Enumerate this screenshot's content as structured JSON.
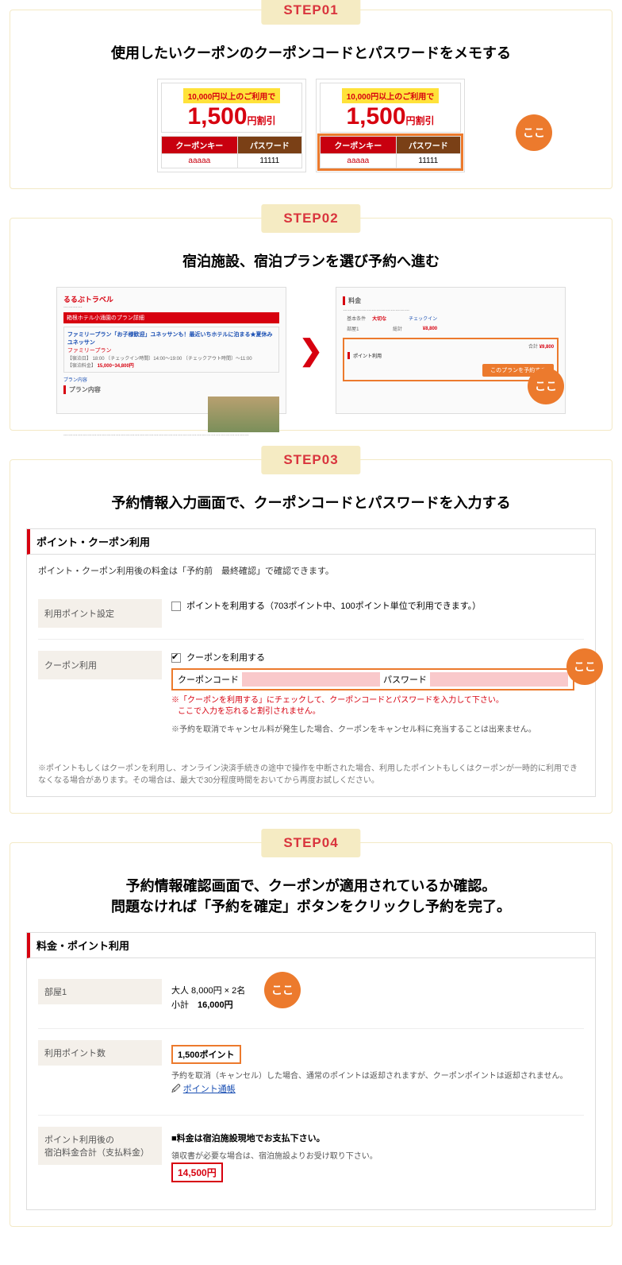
{
  "common": {
    "koko": "ここ",
    "arrow": "❯"
  },
  "step1": {
    "tab": "STEP01",
    "title": "使用したいクーポンのクーポンコードとパスワードをメモする",
    "coupon": {
      "condition": "10,000円以上のご利用で",
      "amount": "1,500",
      "unit": "円割引",
      "key_header": "クーポンキー",
      "pw_header": "パスワード",
      "key_value": "aaaaa",
      "pw_value": "11111"
    }
  },
  "step2": {
    "tab": "STEP02",
    "title": "宿泊施設、宿泊プランを選び予約へ進む",
    "left": {
      "logo": "るるぶトラベル",
      "bar": "箱根ホテル小涌園のプラン詳細",
      "plan_title": "ファミリープラン「お子様歓迎」ユネッサンも！最近いちホテルに泊まる★夏休みユネッサン",
      "plan_sub": "ファミリープラン",
      "plan_link": "プラン内容",
      "date_label": "【宿泊日】",
      "checkin": "18:00 〔チェックイン時間〕14:00～19:00",
      "checkout": "〔チェックアウト時間〕～11:00",
      "price_label": "【宿泊料金】",
      "price": "15,000~34,800円"
    },
    "right": {
      "header": "料金",
      "client_lbl": "基本条件",
      "required": "大切な",
      "room_lbl": "部屋1",
      "total_lbl": "総計",
      "total_val": "¥8,800",
      "sum_lbl": "合計",
      "sum_val": "¥9,800",
      "points": "ポイント利用",
      "button": "このプランを予約する"
    }
  },
  "step3": {
    "tab": "STEP03",
    "title": "予約情報入力画面で、クーポンコードとパスワードを入力する",
    "panel_header": "ポイント・クーポン利用",
    "note": "ポイント・クーポン利用後の料金は「予約前　最終確認」で確認できます。",
    "point_label": "利用ポイント設定",
    "point_text": "ポイントを利用する（703ポイント中、100ポイント単位で利用できます。）",
    "coupon_label": "クーポン利用",
    "coupon_use": "クーポンを利用する",
    "code_label": "クーポンコード",
    "pw_label": "パスワード",
    "warn1": "※「クーポンを利用する」にチェックして、クーポンコードとパスワードを入力して下さい。",
    "warn2": "ここで入力を忘れると割引されません。",
    "cancel_note": "※予約を取消でキャンセル料が発生した場合、クーポンをキャンセル料に充当することは出来ません。",
    "foot": "※ポイントもしくはクーポンを利用し、オンライン決済手続きの途中で操作を中断された場合、利用したポイントもしくはクーポンが一時的に利用できなくなる場合があります。その場合は、最大で30分程度時間をおいてから再度お試しください。"
  },
  "step4": {
    "tab": "STEP04",
    "title1": "予約情報確認画面で、クーポンが適用されているか確認。",
    "title2": "問題なければ「予約を確定」ボタンをクリックし予約を完了。",
    "panel_header": "料金・ポイント利用",
    "room_label": "部屋1",
    "room_line1": "大人 8,000円 × 2名",
    "room_line2_lbl": "小計",
    "room_line2_val": "16,000円",
    "points_label": "利用ポイント数",
    "points_value": "1,500ポイント",
    "points_note": "予約を取消（キャンセル）した場合、通常のポイントは返却されますが、クーポンポイントは返却されません。",
    "points_link": "ポイント通帳",
    "points_link_icon": "🖉",
    "total_label1": "ポイント利用後の",
    "total_label2": "宿泊料金合計（支払料金）",
    "total_msg": "■料金は宿泊施設現地でお支払下さい。",
    "total_sub": "領収書が必要な場合は、宿泊施設よりお受け取り下さい。",
    "total_price": "14,500円"
  }
}
